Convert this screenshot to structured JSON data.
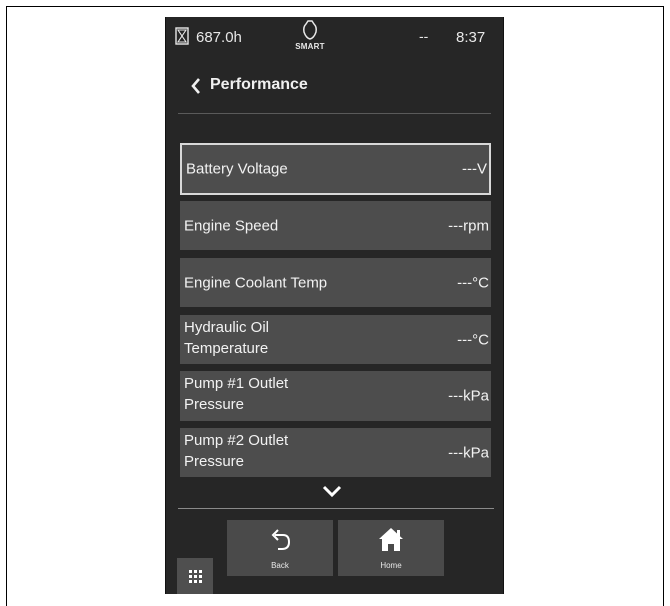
{
  "status": {
    "hour_icon": "hourglass-icon",
    "hours": "687.0h",
    "smart_icon": "engine-smart-icon",
    "smart_label": "SMART",
    "dash": "--",
    "time": "8:37"
  },
  "header": {
    "back_icon": "chevron-left-icon",
    "title": "Performance"
  },
  "items": [
    {
      "label": "Battery Voltage",
      "value": "---V"
    },
    {
      "label": "Engine Speed",
      "value": "---rpm"
    },
    {
      "label": "Engine Coolant Temp",
      "value": "---°C"
    },
    {
      "label_line1": "Hydraulic Oil",
      "label_line2": "Temperature",
      "value": "---°C"
    },
    {
      "label_line1": "Pump #1 Outlet",
      "label_line2": "Pressure",
      "value": "---kPa"
    },
    {
      "label_line1": "Pump #2 Outlet",
      "label_line2": "Pressure",
      "value": "---kPa"
    }
  ],
  "scroll_icon": "chevron-down-icon",
  "footer": {
    "menu_icon": "grid-menu-icon",
    "back_label": "Back",
    "back_icon": "undo-arrow-icon",
    "home_label": "Home",
    "home_icon": "home-icon"
  }
}
